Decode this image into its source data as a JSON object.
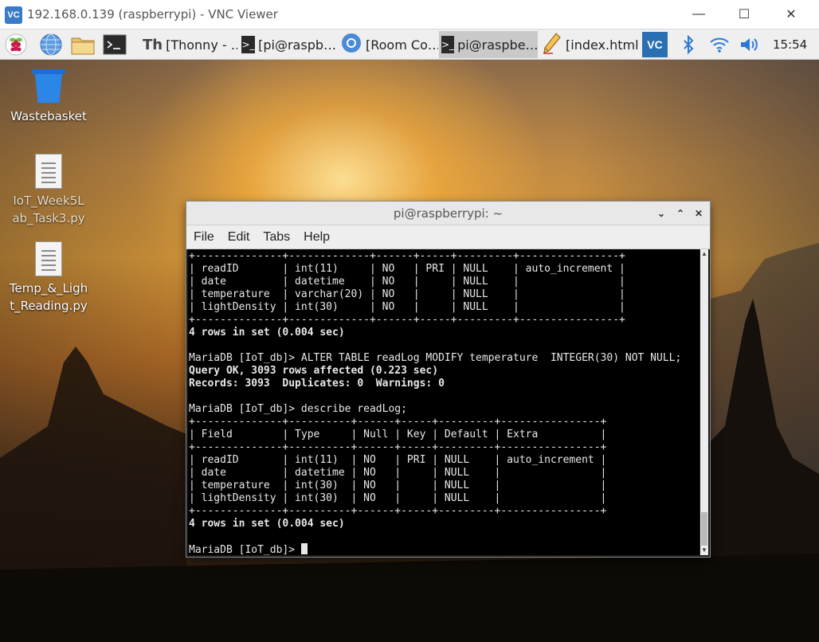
{
  "window": {
    "logo_text": "VC",
    "title": "192.168.0.139 (raspberrypi) - VNC Viewer",
    "minimize_glyph": "—",
    "maximize_glyph": "☐",
    "close_glyph": "✕"
  },
  "panel": {
    "launchers": [
      "raspberry-menu-icon",
      "web-browser-icon",
      "file-manager-icon",
      "terminal-icon"
    ],
    "tasks": [
      {
        "label": "[Thonny  -  …",
        "icon": "thonny-icon",
        "active": false
      },
      {
        "label": "[pi@raspb…",
        "icon": "terminal-icon",
        "active": false
      },
      {
        "label": "[Room Co…",
        "icon": "chromium-icon",
        "active": false
      },
      {
        "label": "pi@raspbe…",
        "icon": "terminal-icon",
        "active": true
      },
      {
        "label": "[index.html…",
        "icon": "text-editor-icon",
        "active": false
      }
    ],
    "tray": [
      "vnc-icon",
      "bluetooth-icon",
      "wifi-icon",
      "volume-icon"
    ],
    "clock": "15:54"
  },
  "desktop": {
    "icons": [
      {
        "label": "Wastebasket",
        "icon": "wastebasket-icon"
      },
      {
        "label": "IoT_Week5Lab_Task3.py",
        "icon": "python-file-icon"
      },
      {
        "label": "Temp_&_Light_Reading.py",
        "icon": "python-file-icon"
      }
    ]
  },
  "terminal": {
    "title": "pi@raspberrypi: ~",
    "menu": [
      "File",
      "Edit",
      "Tabs",
      "Help"
    ],
    "prompt": "MariaDB [IoT_db]>",
    "lines": [
      {
        "text": "+--------------+-------------+------+-----+---------+----------------+",
        "bold": false
      },
      {
        "text": "| readID       | int(11)     | NO   | PRI | NULL    | auto_increment |",
        "bold": false
      },
      {
        "text": "| date         | datetime    | NO   |     | NULL    |                |",
        "bold": false
      },
      {
        "text": "| temperature  | varchar(20) | NO   |     | NULL    |                |",
        "bold": false
      },
      {
        "text": "| lightDensity | int(30)     | NO   |     | NULL    |                |",
        "bold": false
      },
      {
        "text": "+--------------+-------------+------+-----+---------+----------------+",
        "bold": false
      },
      {
        "text": "4 rows in set (0.004 sec)",
        "bold": true
      },
      {
        "text": "",
        "bold": false
      },
      {
        "text": "MariaDB [IoT_db]> ALTER TABLE readLog MODIFY temperature  INTEGER(30) NOT NULL;",
        "bold": false
      },
      {
        "text": "Query OK, 3093 rows affected (0.223 sec)",
        "bold": true
      },
      {
        "text": "Records: 3093  Duplicates: 0  Warnings: 0",
        "bold": true
      },
      {
        "text": "",
        "bold": false
      },
      {
        "text": "MariaDB [IoT_db]> describe readLog;",
        "bold": false
      },
      {
        "text": "+--------------+----------+------+-----+---------+----------------+",
        "bold": false
      },
      {
        "text": "| Field        | Type     | Null | Key | Default | Extra          |",
        "bold": false
      },
      {
        "text": "+--------------+----------+------+-----+---------+----------------+",
        "bold": false
      },
      {
        "text": "| readID       | int(11)  | NO   | PRI | NULL    | auto_increment |",
        "bold": false
      },
      {
        "text": "| date         | datetime | NO   |     | NULL    |                |",
        "bold": false
      },
      {
        "text": "| temperature  | int(30)  | NO   |     | NULL    |                |",
        "bold": false
      },
      {
        "text": "| lightDensity | int(30)  | NO   |     | NULL    |                |",
        "bold": false
      },
      {
        "text": "+--------------+----------+------+-----+---------+----------------+",
        "bold": false
      },
      {
        "text": "4 rows in set (0.004 sec)",
        "bold": true
      },
      {
        "text": "",
        "bold": false
      }
    ]
  },
  "colors": {
    "terminal_bg": "#000000",
    "terminal_fg": "#e8e8e8",
    "panel_bg": "#efefef",
    "vnc_accent": "#3a7bc8"
  }
}
